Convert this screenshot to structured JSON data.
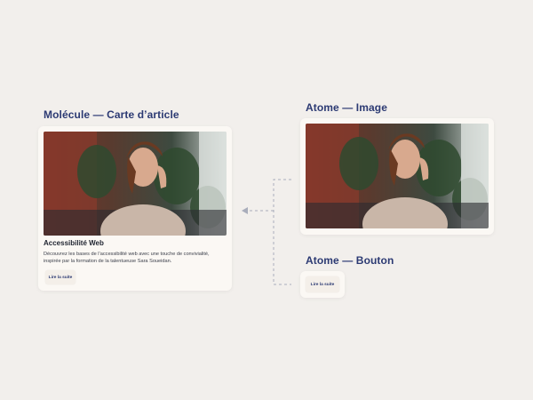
{
  "molecule": {
    "heading": "Molécule — Carte d’article",
    "article_title": "Accessibilité Web",
    "article_description": "Découvrez les bases de l’accessibilité web avec une touche de convivialité, inspirée par la formation de la talentueuse Sara Soueidan.",
    "button_label": "Lire la suite"
  },
  "atom_image": {
    "heading": "Atome — Image"
  },
  "atom_button": {
    "heading": "Atome — Bouton",
    "button_label": "Lire la suite"
  },
  "colors": {
    "background": "#f2efec",
    "card": "#fbf8f4",
    "heading": "#2c3a73",
    "connector": "#a9adbb"
  },
  "icons": [
    "photo-woman-icon",
    "arrow-left-icon"
  ]
}
